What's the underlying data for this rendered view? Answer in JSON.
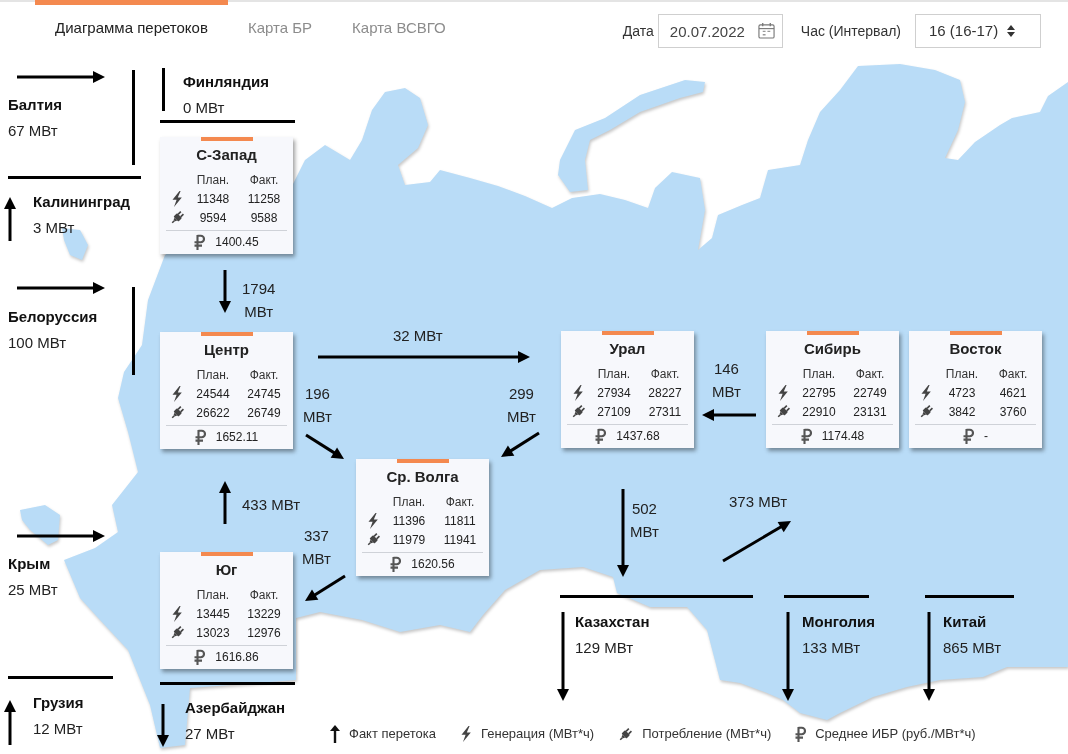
{
  "tabs": [
    {
      "label": "Диаграмма перетоков",
      "selected": true
    },
    {
      "label": "Карта БР",
      "selected": false
    },
    {
      "label": "Карта ВСВГО",
      "selected": false
    }
  ],
  "filters": {
    "date": {
      "label": "Дата",
      "value": "20.07.2022"
    },
    "hour": {
      "label": "Час (Интервал)",
      "value": "16 (16-17)"
    }
  },
  "neighbors": [
    {
      "name": "Балтия",
      "flow": "67 МВт",
      "kind": "right"
    },
    {
      "name": "Финляндия",
      "flow": "0 МВт",
      "kind": "none"
    },
    {
      "name": "Калининград",
      "flow": "3 МВт",
      "kind": "up"
    },
    {
      "name": "Белоруссия",
      "flow": "100 МВт",
      "kind": "right"
    },
    {
      "name": "Крым",
      "flow": "25 МВт",
      "kind": "right"
    },
    {
      "name": "Грузия",
      "flow": "12 МВт",
      "kind": "up"
    },
    {
      "name": "Азербайджан",
      "flow": "27 МВт",
      "kind": "down"
    },
    {
      "name": "Казахстан",
      "flow": "129 МВт",
      "kind": "down"
    },
    {
      "name": "Монголия",
      "flow": "133 МВт",
      "kind": "down"
    },
    {
      "name": "Китай",
      "flow": "865 МВт",
      "kind": "down"
    }
  ],
  "regions": [
    {
      "name": "С-Запад",
      "columns": [
        "План.",
        "Факт."
      ],
      "rows": [
        {
          "kind": "generation",
          "plan": "11348",
          "fact": "11258"
        },
        {
          "kind": "consumption",
          "plan": "9594",
          "fact": "9588"
        }
      ],
      "price": "1400.45"
    },
    {
      "name": "Центр",
      "columns": [
        "План.",
        "Факт."
      ],
      "rows": [
        {
          "kind": "generation",
          "plan": "24544",
          "fact": "24745"
        },
        {
          "kind": "consumption",
          "plan": "26622",
          "fact": "26749"
        }
      ],
      "price": "1652.11"
    },
    {
      "name": "Урал",
      "columns": [
        "План.",
        "Факт."
      ],
      "rows": [
        {
          "kind": "generation",
          "plan": "27934",
          "fact": "28227"
        },
        {
          "kind": "consumption",
          "plan": "27109",
          "fact": "27311"
        }
      ],
      "price": "1437.68"
    },
    {
      "name": "Сибирь",
      "columns": [
        "План.",
        "Факт."
      ],
      "rows": [
        {
          "kind": "generation",
          "plan": "22795",
          "fact": "22749"
        },
        {
          "kind": "consumption",
          "plan": "22910",
          "fact": "23131"
        }
      ],
      "price": "1174.48"
    },
    {
      "name": "Восток",
      "columns": [
        "План.",
        "Факт."
      ],
      "rows": [
        {
          "kind": "generation",
          "plan": "4723",
          "fact": "4621"
        },
        {
          "kind": "consumption",
          "plan": "3842",
          "fact": "3760"
        }
      ],
      "price": "-"
    },
    {
      "name": "Ср. Волга",
      "columns": [
        "План.",
        "Факт."
      ],
      "rows": [
        {
          "kind": "generation",
          "plan": "11396",
          "fact": "11811"
        },
        {
          "kind": "consumption",
          "plan": "11979",
          "fact": "11941"
        }
      ],
      "price": "1620.56"
    },
    {
      "name": "Юг",
      "columns": [
        "План.",
        "Факт."
      ],
      "rows": [
        {
          "kind": "generation",
          "plan": "13445",
          "fact": "13229"
        },
        {
          "kind": "consumption",
          "plan": "13023",
          "fact": "12976"
        }
      ],
      "price": "1616.86"
    }
  ],
  "flows": [
    {
      "value": "1794 МВт",
      "kind": "down"
    },
    {
      "value": "32 МВт",
      "kind": "right"
    },
    {
      "value": "196 МВт",
      "kind": "downright"
    },
    {
      "value": "299 МВт",
      "kind": "downleft"
    },
    {
      "value": "146 МВт",
      "kind": "left"
    },
    {
      "value": "433 МВт",
      "kind": "up"
    },
    {
      "value": "337 МВт",
      "kind": "downleft"
    },
    {
      "value": "502 МВт",
      "kind": "down"
    },
    {
      "value": "373 МВт",
      "kind": "upright"
    }
  ],
  "legend": [
    {
      "kind": "flow",
      "label": "Факт перетока"
    },
    {
      "kind": "generation",
      "label": "Генерация (МВт*ч)"
    },
    {
      "kind": "consumption",
      "label": "Потребление (МВт*ч)"
    },
    {
      "kind": "price",
      "label": "Среднее ИБР (руб./МВт*ч)"
    }
  ]
}
